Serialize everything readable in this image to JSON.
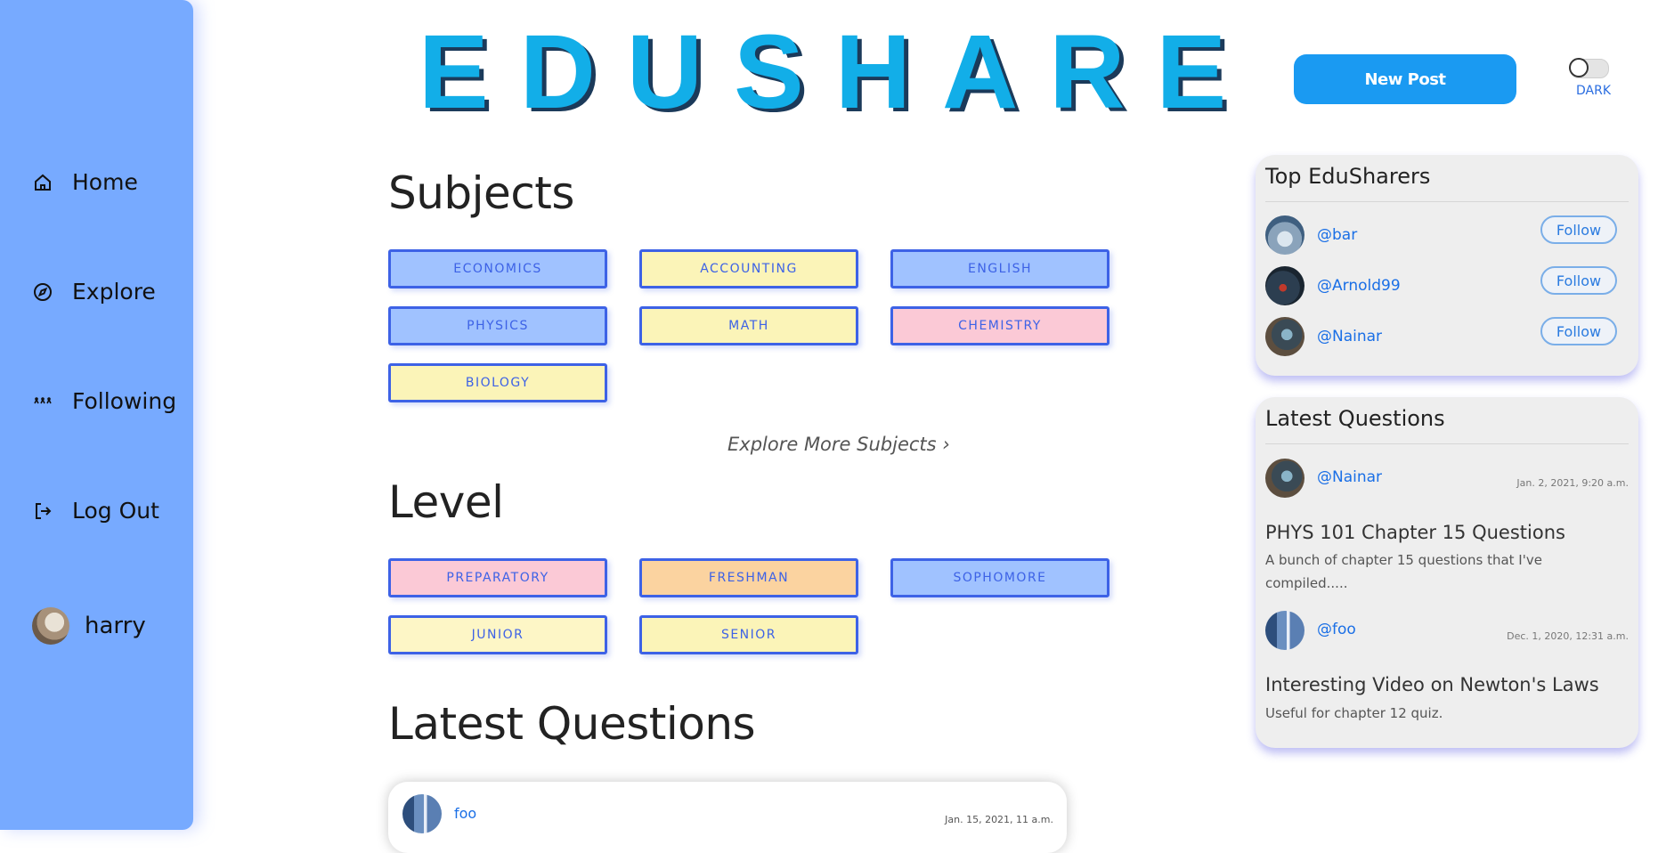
{
  "sidebar": {
    "items": [
      {
        "label": "Home",
        "icon": "home-icon"
      },
      {
        "label": "Explore",
        "icon": "compass-icon"
      },
      {
        "label": "Following",
        "icon": "people-icon"
      },
      {
        "label": "Log Out",
        "icon": "logout-icon"
      }
    ],
    "user": {
      "name": "harry"
    }
  },
  "header": {
    "logo": "EDUSHARE",
    "new_post_label": "New Post",
    "theme_toggle_label": "DARK"
  },
  "subjects": {
    "title": "Subjects",
    "items": [
      "ECONOMICS",
      "ACCOUNTING",
      "ENGLISH",
      "PHYSICS",
      "MATH",
      "CHEMISTRY",
      "BIOLOGY"
    ],
    "explore_more": "Explore More Subjects ›"
  },
  "level": {
    "title": "Level",
    "items": [
      "PREPARATORY",
      "FRESHMAN",
      "SOPHOMORE",
      "JUNIOR",
      "SENIOR"
    ]
  },
  "latest_questions": {
    "title": "Latest Questions",
    "cards": [
      {
        "user": "foo",
        "date": "Jan. 15, 2021, 11 a.m."
      }
    ]
  },
  "top_edusharers": {
    "title": "Top EduSharers",
    "users": [
      {
        "handle": "@bar",
        "follow_label": "Follow"
      },
      {
        "handle": "@Arnold99",
        "follow_label": "Follow"
      },
      {
        "handle": "@Nainar",
        "follow_label": "Follow"
      }
    ]
  },
  "side_latest_questions": {
    "title": "Latest Questions",
    "items": [
      {
        "user": "@Nainar",
        "date": "Jan. 2, 2021, 9:20 a.m.",
        "title": "PHYS 101 Chapter 15 Questions",
        "body": "A bunch of chapter 15 questions that I've compiled....."
      },
      {
        "user": "@foo",
        "date": "Dec. 1, 2020, 12:31 a.m.",
        "title": "Interesting Video on Newton's Laws",
        "body": "Useful for chapter 12 quiz."
      }
    ]
  },
  "colors": {
    "sidebar": "#77aaff",
    "accent": "#1a9af2",
    "tag_border": "#3d62e6"
  }
}
